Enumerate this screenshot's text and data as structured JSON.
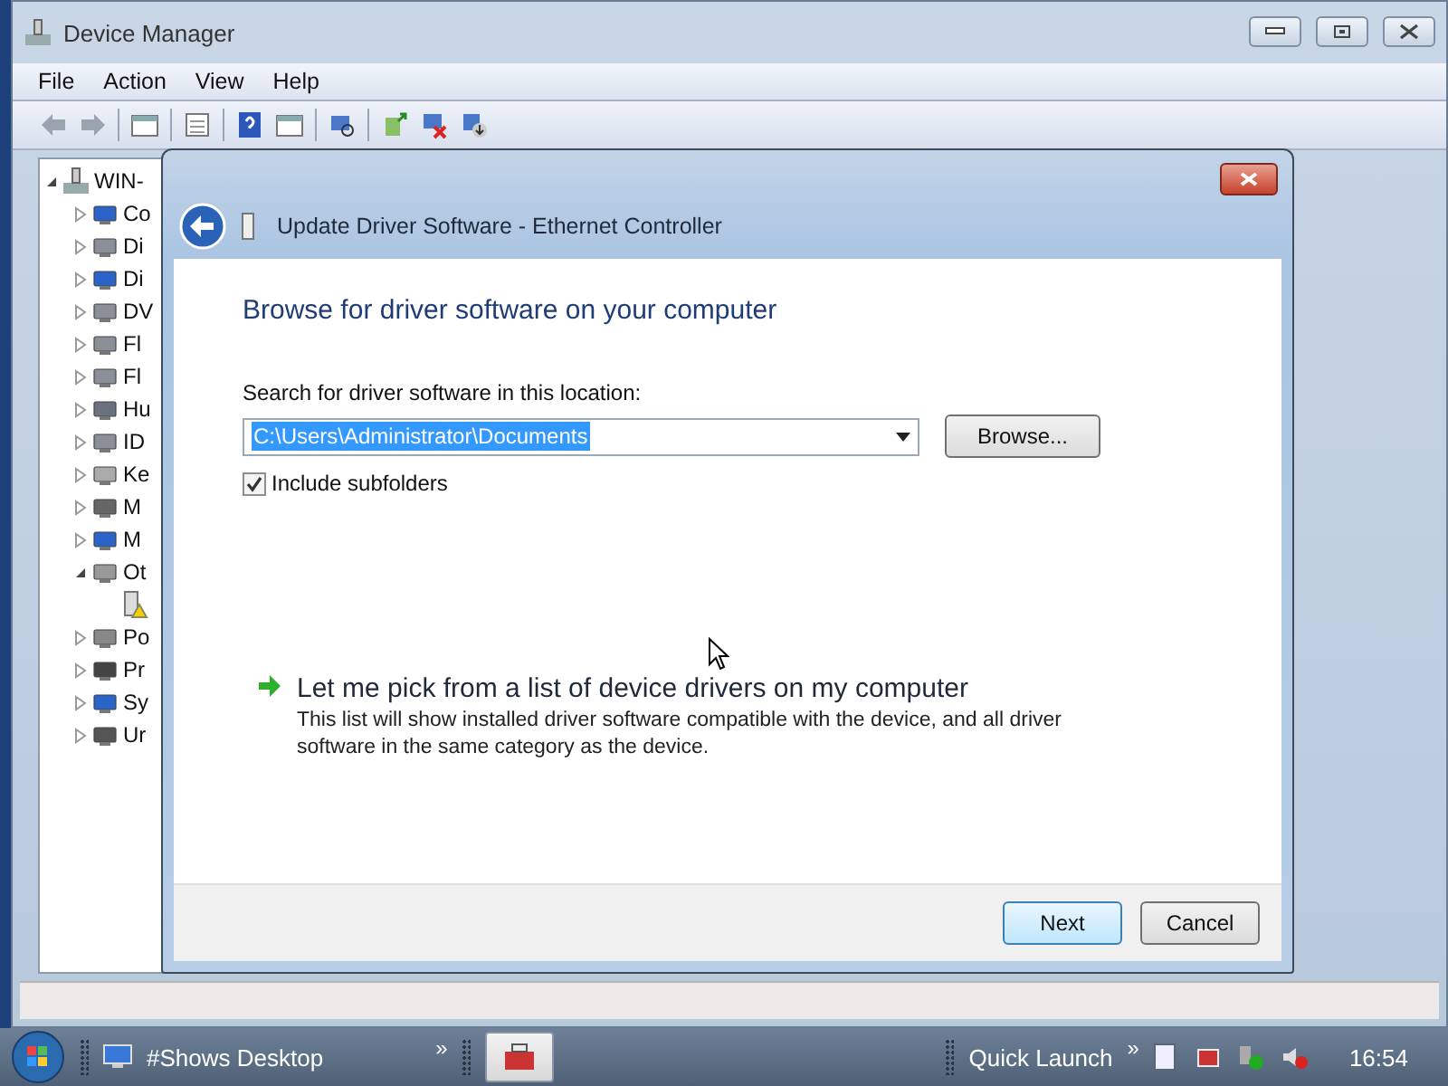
{
  "window": {
    "title": "Device Manager"
  },
  "menu": [
    "File",
    "Action",
    "View",
    "Help"
  ],
  "tree": {
    "label": "WIN-",
    "expanded": true,
    "children": [
      {
        "label": "Co",
        "expanded": false
      },
      {
        "label": "Di",
        "expanded": false
      },
      {
        "label": "Di",
        "expanded": false
      },
      {
        "label": "DV",
        "expanded": false
      },
      {
        "label": "Fl",
        "expanded": false
      },
      {
        "label": "Fl",
        "expanded": false
      },
      {
        "label": "Hu",
        "expanded": false
      },
      {
        "label": "ID",
        "expanded": false
      },
      {
        "label": "Ke",
        "expanded": false
      },
      {
        "label": "M",
        "expanded": false
      },
      {
        "label": "M",
        "expanded": false
      },
      {
        "label": "Ot",
        "expanded": true,
        "children": [
          {
            "warning": true
          }
        ]
      },
      {
        "label": "Po",
        "expanded": false
      },
      {
        "label": "Pr",
        "expanded": false
      },
      {
        "label": "Sy",
        "expanded": false
      },
      {
        "label": "Ur",
        "expanded": false
      }
    ]
  },
  "dialog": {
    "title": "Update Driver Software - Ethernet Controller",
    "heading": "Browse for driver software on your computer",
    "location_label": "Search for driver software in this location:",
    "location": {
      "value": "C:\\Users\\Administrator\\Documents",
      "selected": true
    },
    "browse_button": "Browse...",
    "include_subfolders": {
      "label": "Include subfolders",
      "checked": true
    },
    "pick_link": "Let me pick from a list of device drivers on my computer",
    "pick_description": "This list will show installed driver software compatible with the device, and all driver software in the same category as the device.",
    "buttons": [
      {
        "label": "Next",
        "default": true
      },
      {
        "label": "Cancel",
        "default": false
      }
    ]
  },
  "taskbar": {
    "desktop_label": "#Shows Desktop",
    "quick_launch": "Quick Launch",
    "chevrons": [
      "»",
      "»"
    ],
    "clock": "16:54"
  }
}
